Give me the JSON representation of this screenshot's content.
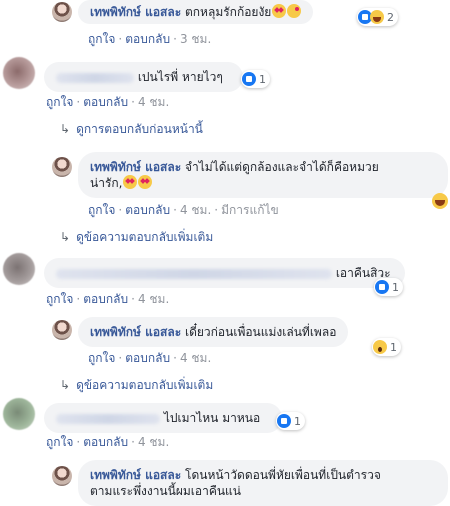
{
  "comments": [
    {
      "author": "เทพพิทักษ์ แอสละ",
      "text": "ตกหลุมรักก้อยงัย",
      "emojis": [
        "heart-eyes-emoji",
        "kissing-emoji"
      ],
      "reactions": {
        "icons": [
          "like-icon",
          "haha-icon"
        ],
        "count": "2"
      },
      "actions": {
        "like": "ถูกใจ",
        "reply": "ตอบกลับ",
        "time": "3 ชม."
      }
    },
    {
      "author": "",
      "text": "เปนไรพี่ หายไวๆ",
      "reactions": {
        "icons": [
          "like-icon"
        ],
        "count": "1"
      },
      "actions": {
        "like": "ถูกใจ",
        "reply": "ตอบกลับ",
        "time": "4 ชม."
      },
      "toggle": "ดูการตอบกลับก่อนหน้านี้"
    },
    {
      "author": "เทพพิทักษ์ แอสละ",
      "line1": "จำไม่ได้แต่ดูกล้องและจำได้ก็คือหมวย",
      "line2": "น่ารัก,",
      "emojis": [
        "heart-eyes-emoji",
        "heart-eyes-emoji"
      ],
      "side_emoji": "laughing-emoji",
      "actions": {
        "like": "ถูกใจ",
        "reply": "ตอบกลับ",
        "time": "4 ชม.",
        "edited": "มีการแก้ไข"
      },
      "toggle": "ดูข้อความตอบกลับเพิ่มเติม"
    },
    {
      "author": "",
      "text": "เอาคืนสิวะ",
      "reactions": {
        "icons": [
          "like-icon"
        ],
        "count": "1"
      },
      "actions": {
        "like": "ถูกใจ",
        "reply": "ตอบกลับ",
        "time": "4 ชม."
      }
    },
    {
      "author": "เทพพิทักษ์ แอสละ",
      "text": "เดี๋ยวก่อนเพื่อนแม่งเล่นที่เพลอ",
      "reactions": {
        "icons": [
          "wow-icon"
        ],
        "count": "1"
      },
      "actions": {
        "like": "ถูกใจ",
        "reply": "ตอบกลับ",
        "time": "4 ชม."
      },
      "toggle": "ดูข้อความตอบกลับเพิ่มเติม"
    },
    {
      "author": "",
      "text": "ไปเมาไหน มาหนอ",
      "reactions": {
        "icons": [
          "like-icon"
        ],
        "count": "1"
      },
      "actions": {
        "like": "ถูกใจ",
        "reply": "ตอบกลับ",
        "time": "4 ชม."
      }
    },
    {
      "author": "เทพพิทักษ์ แอสละ",
      "line1": "โดนหน้าวัดดอนพี่หัยเพื่อนที่เป็นตำรวจ",
      "line2": "ตามแระพึ่งงานนี้ผมเอาคืนแน่"
    }
  ],
  "colors": {
    "bubble": "#f2f3f5",
    "author": "#385898",
    "link": "#385898",
    "meta": "#90949c",
    "like_blue": "#1877f2"
  }
}
